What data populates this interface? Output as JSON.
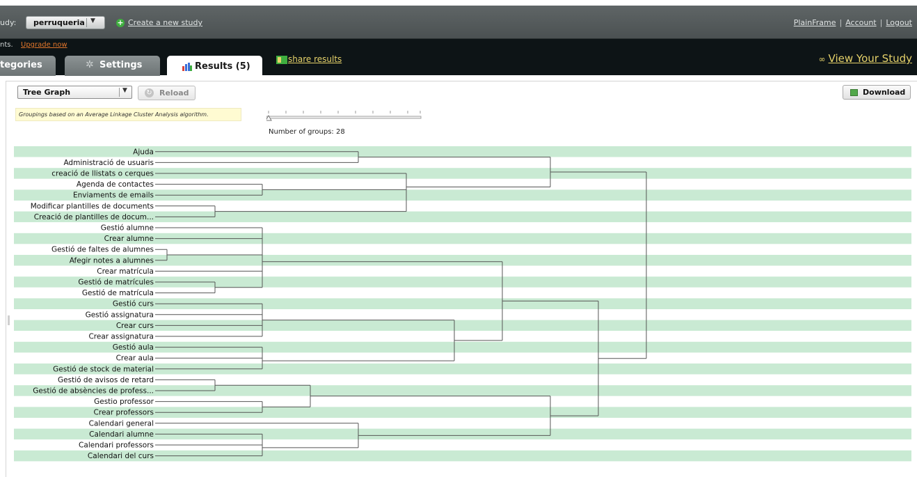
{
  "header": {
    "study_label": "udy:",
    "study_selected": "perruqueria",
    "create_link": "Create a new study",
    "links": [
      "PlainFrame",
      "Account",
      "Logout"
    ],
    "upgrade_prefix": "nts.",
    "upgrade_link": "Upgrade now"
  },
  "tabs": {
    "categories": "tegories",
    "settings": "Settings",
    "results": "Results (5)"
  },
  "share_link": "share results",
  "view_study": "View Your Study",
  "toolbar": {
    "view_select": "Tree Graph",
    "reload_label": "Reload",
    "download_label": "Download"
  },
  "algorithm_note": "Groupings based on an Average Linkage Cluster Analysis algorithm.",
  "groups_text": "Number of groups: 28",
  "tree": {
    "leaves": [
      "Ajuda",
      "Administració de usuaris",
      "creació de llistats o cerques",
      "Agenda de contactes",
      "Enviaments de emails",
      "Modificar plantilles de documents",
      "Creació de plantilles de docum...",
      "Gestió alumne",
      "Crear alumne",
      "Gestió de faltes de alumnes",
      "Afegir notes a alumnes",
      "Crear matrícula",
      "Gestió de matrícules",
      "Gestió de matrícula",
      "Gestió curs",
      "Gestió assignatura",
      "Crear curs",
      "Crear assignatura",
      "Gestió aula",
      "Crear aula",
      "Gestió de stock de material",
      "Gestió de avisos de retard",
      "Gestió de absències de profess...",
      "Gestio professor",
      "Crear professors",
      "Calendari general",
      "Calendari alumne",
      "Calendari professors",
      "Calendari del curs"
    ],
    "stripe_color": "#c9ead3",
    "line_color": "#555555"
  }
}
